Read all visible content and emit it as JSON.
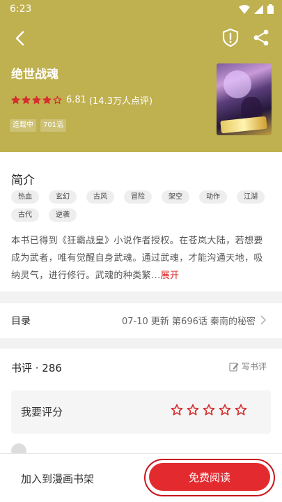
{
  "status_bar": {
    "time": "6:23"
  },
  "book": {
    "title": "绝世战魂",
    "rating_score": "6.81",
    "rating_count": "(14.3万人点评)",
    "stars_filled": 4,
    "badges": [
      "连载中",
      "701话"
    ]
  },
  "intro": {
    "heading": "简介",
    "tags": [
      "热血",
      "玄幻",
      "古风",
      "冒险",
      "架空",
      "动作",
      "江湖",
      "古代",
      "逆袭"
    ],
    "text": "本书已得到《狂霸战皇》小说作者授权。在苍岚大陆，若想要成为武者，唯有觉醒自身武魂。通过武魂，才能沟通天地，吸纳灵气，进行修行。武魂的种类繁...",
    "more_label": "展开"
  },
  "toc": {
    "label": "目录",
    "update_date": "07-10",
    "update_word": "更新",
    "latest_chapter": "第696话 秦南的秘密"
  },
  "reviews": {
    "title": "书评 · 286",
    "write_label": "写书评",
    "rate_label": "我要评分"
  },
  "bottom": {
    "shelf_label": "加入到漫画书架",
    "read_label": "免费阅读"
  },
  "colors": {
    "header_bg": "#bfb050",
    "accent_red": "#e32a2f",
    "star_red": "#d62d2d"
  }
}
